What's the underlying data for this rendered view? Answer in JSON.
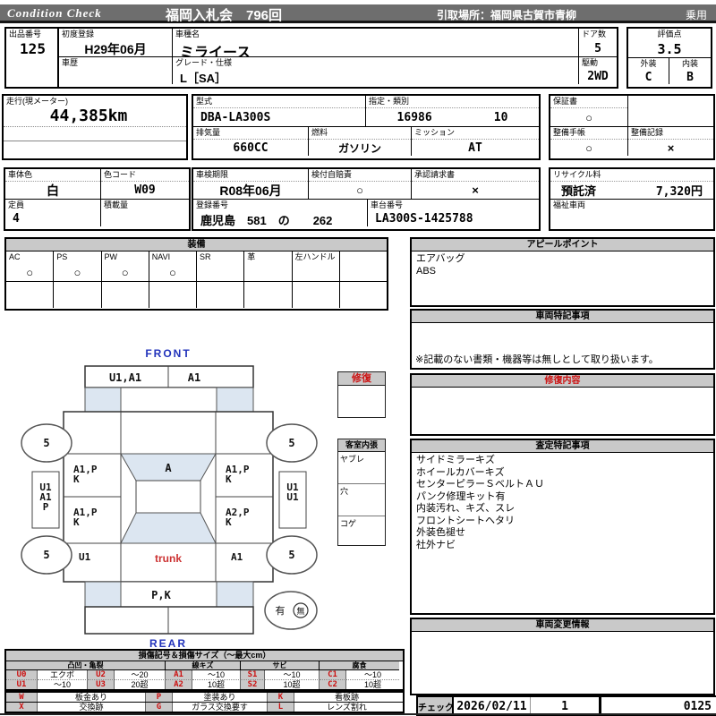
{
  "topbar": {
    "brand": "Condition  Check",
    "auction": "福岡入札会　796回",
    "pickup": "引取場所：福岡県古賀市青柳",
    "category": "乗用"
  },
  "header": {
    "lot_label": "出品番号",
    "lot_no": "125",
    "first_reg_label": "初度登録",
    "first_reg": "H29年06月",
    "history_label": "車歴",
    "history": "",
    "model_label": "車種名",
    "model": "ミライース",
    "grade_label": "グレード・仕様",
    "grade": "L［SA］",
    "doors_label": "ドア数",
    "doors": "5",
    "drive_label": "駆動",
    "drive": "2WD",
    "score_label": "評価点",
    "score": "3.5",
    "ext_label": "外装",
    "ext": "C",
    "int_label": "内装",
    "int": "B"
  },
  "spec": {
    "mileage_label": "走行(現メーター)",
    "mileage": "44,385km",
    "model_code_label": "型式",
    "model_code": "DBA-LA300S",
    "class_label": "指定・類別",
    "class1": "16986",
    "class2": "10",
    "warranty_label": "保証書",
    "warranty": "○",
    "disp_label": "排気量",
    "disp": "660CC",
    "fuel_label": "燃料",
    "fuel": "ガソリン",
    "mission_label": "ミッション",
    "mission": "AT",
    "book_label": "整備手帳",
    "book": "○",
    "record_label": "整備記録",
    "record": "×"
  },
  "reg": {
    "color_label": "車体色",
    "color": "白",
    "color_code_label": "色コード",
    "color_code": "W09",
    "inspect_label": "車検期限",
    "inspect": "R08年06月",
    "jibaiseki_label": "検付自賠責",
    "jibaiseki": "○",
    "approval_label": "承認請求書",
    "approval": "×",
    "recycle_label": "リサイクル料",
    "recycle_status": "預託済",
    "recycle_fee": "7,320円",
    "seats_label": "定員",
    "seats": "4",
    "payload_label": "積載量",
    "payload": "",
    "plate_label": "登録番号",
    "plate": "鹿児島　581　の　　262",
    "vin_label": "車台番号",
    "vin": "LA300S-1425788",
    "welfare_label": "福祉車両",
    "welfare": ""
  },
  "equipment": {
    "title": "装備",
    "items": [
      {
        "label": "AC",
        "value": "○"
      },
      {
        "label": "PS",
        "value": "○"
      },
      {
        "label": "PW",
        "value": "○"
      },
      {
        "label": "NAVI",
        "value": "○"
      },
      {
        "label": "SR",
        "value": ""
      },
      {
        "label": "革",
        "value": ""
      },
      {
        "label": "左ハンドル",
        "value": ""
      },
      {
        "label": "",
        "value": ""
      }
    ]
  },
  "appeal": {
    "title": "アピールポイント",
    "lines": [
      "エアバッグ",
      "ABS"
    ]
  },
  "notes": {
    "title": "車両特記事項",
    "note": "※記載のない書類・機器等は無しとして取り扱います。"
  },
  "repair": {
    "title": "修復内容",
    "content": ""
  },
  "assessment": {
    "title": "査定特記事項",
    "lines": [
      "サイドミラーキズ",
      "ホイールカバーキズ",
      "センターピラーＳベルトＡＵ",
      "パンク修理キット有",
      "内装汚れ、キズ、スレ",
      "フロントシートヘタリ",
      "外装色褪せ",
      "社外ナビ"
    ]
  },
  "change_info": {
    "title": "車両変更情報",
    "content": ""
  },
  "check": {
    "label": "チェック",
    "date": "2026/02/11",
    "count": "1",
    "number": "0125"
  },
  "diagram": {
    "front": "FRONT",
    "rear": "REAR",
    "trunk": "trunk",
    "windshield": "A",
    "repair_box": "修復",
    "cabin_title": "客室内張",
    "cabin_rows": [
      "ヤブレ",
      "穴",
      "コゲ"
    ],
    "front_bumper_left": "U1,A1",
    "front_bumper_right": "A1",
    "left_front_door_1": "A1,P",
    "left_front_door_2": "K",
    "left_rear_door_1": "A1,P",
    "left_rear_door_2": "K",
    "left_quarter": "U1",
    "right_front_door_1": "A1,P",
    "right_front_door_2": "K",
    "right_rear_door_1": "A2,P",
    "right_rear_door_2": "K",
    "right_quarter": "A1",
    "rear_bumper": "P,K",
    "left_sill": [
      "U1",
      "A1",
      "P"
    ],
    "right_sill": [
      "U1",
      "U1"
    ],
    "tires": {
      "fl": "5",
      "fr": "5",
      "rl": "5",
      "rr": "5"
    },
    "spare": {
      "yes": "有",
      "no": "無"
    }
  },
  "legend": {
    "title": "損傷記号＆損傷サイズ（～最大cm）",
    "groups": [
      "凸凹・亀裂",
      "線キズ",
      "サビ",
      "腐食"
    ],
    "row1": [
      "U0",
      "エクボ",
      "U2",
      "～20",
      "A1",
      "～10",
      "S1",
      "～10",
      "C1",
      "～10"
    ],
    "row2": [
      "U1",
      "～10",
      "U3",
      "20超",
      "A2",
      "10超",
      "S2",
      "10超",
      "C2",
      "10超"
    ],
    "row3": [
      "W",
      "板金あり",
      "P",
      "塗装あり",
      "K",
      "看板跡"
    ],
    "row4": [
      "X",
      "交換跡",
      "G",
      "ガラス交換要す",
      "L",
      "レンズ割れ"
    ]
  },
  "colors": {
    "topbar_bg": "#6e6e6e",
    "section_header_bg": "#c9c9c9",
    "accent_red": "#cc1111",
    "accent_blue": "#2233bb",
    "glass_blue": "#dce6f1"
  }
}
